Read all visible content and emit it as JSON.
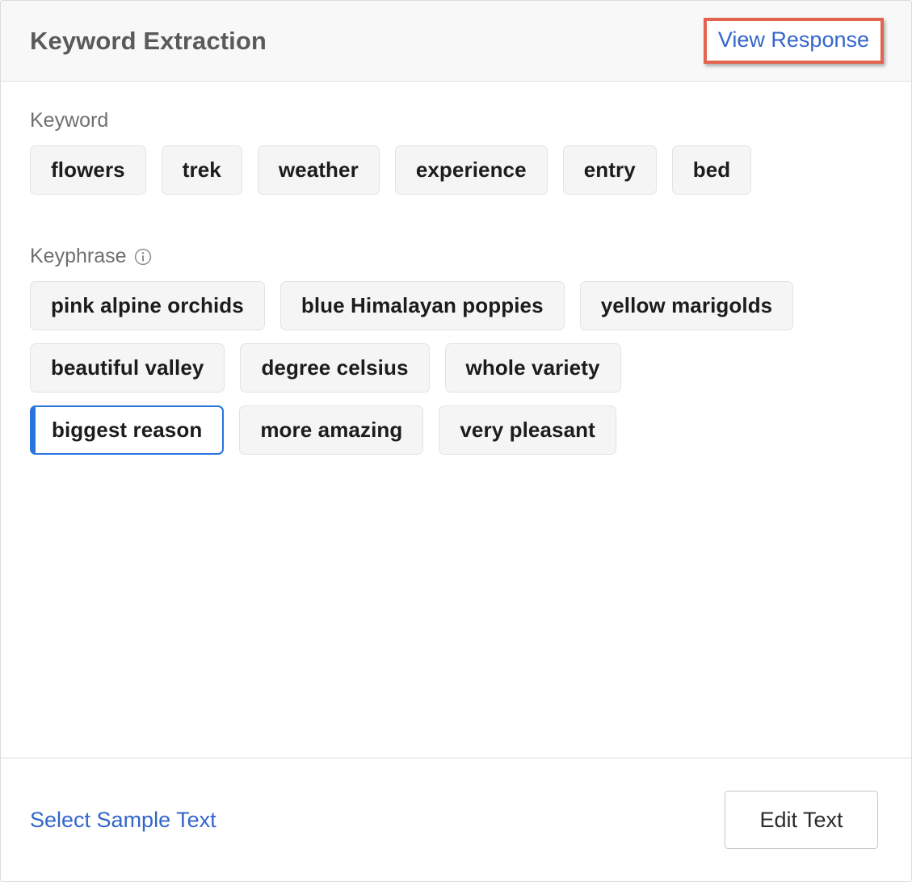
{
  "header": {
    "title": "Keyword Extraction",
    "view_response_label": "View Response",
    "highlight_color": "#e2644f",
    "link_color": "#3366cc"
  },
  "keyword_section": {
    "label": "Keyword",
    "chips": [
      "flowers",
      "trek",
      "weather",
      "experience",
      "entry",
      "bed"
    ]
  },
  "keyphrase_section": {
    "label": "Keyphrase",
    "info_icon": "info-circle-icon",
    "rows": [
      [
        "pink alpine orchids",
        "blue Himalayan poppies",
        "yellow marigolds"
      ],
      [
        "beautiful valley",
        "degree celsius",
        "whole variety"
      ],
      [
        "biggest reason",
        "more amazing",
        "very pleasant"
      ]
    ],
    "selected_chip": "biggest reason",
    "selected_accent_color": "#2a74e0"
  },
  "footer": {
    "select_sample_text_label": "Select Sample Text",
    "edit_text_label": "Edit Text"
  }
}
